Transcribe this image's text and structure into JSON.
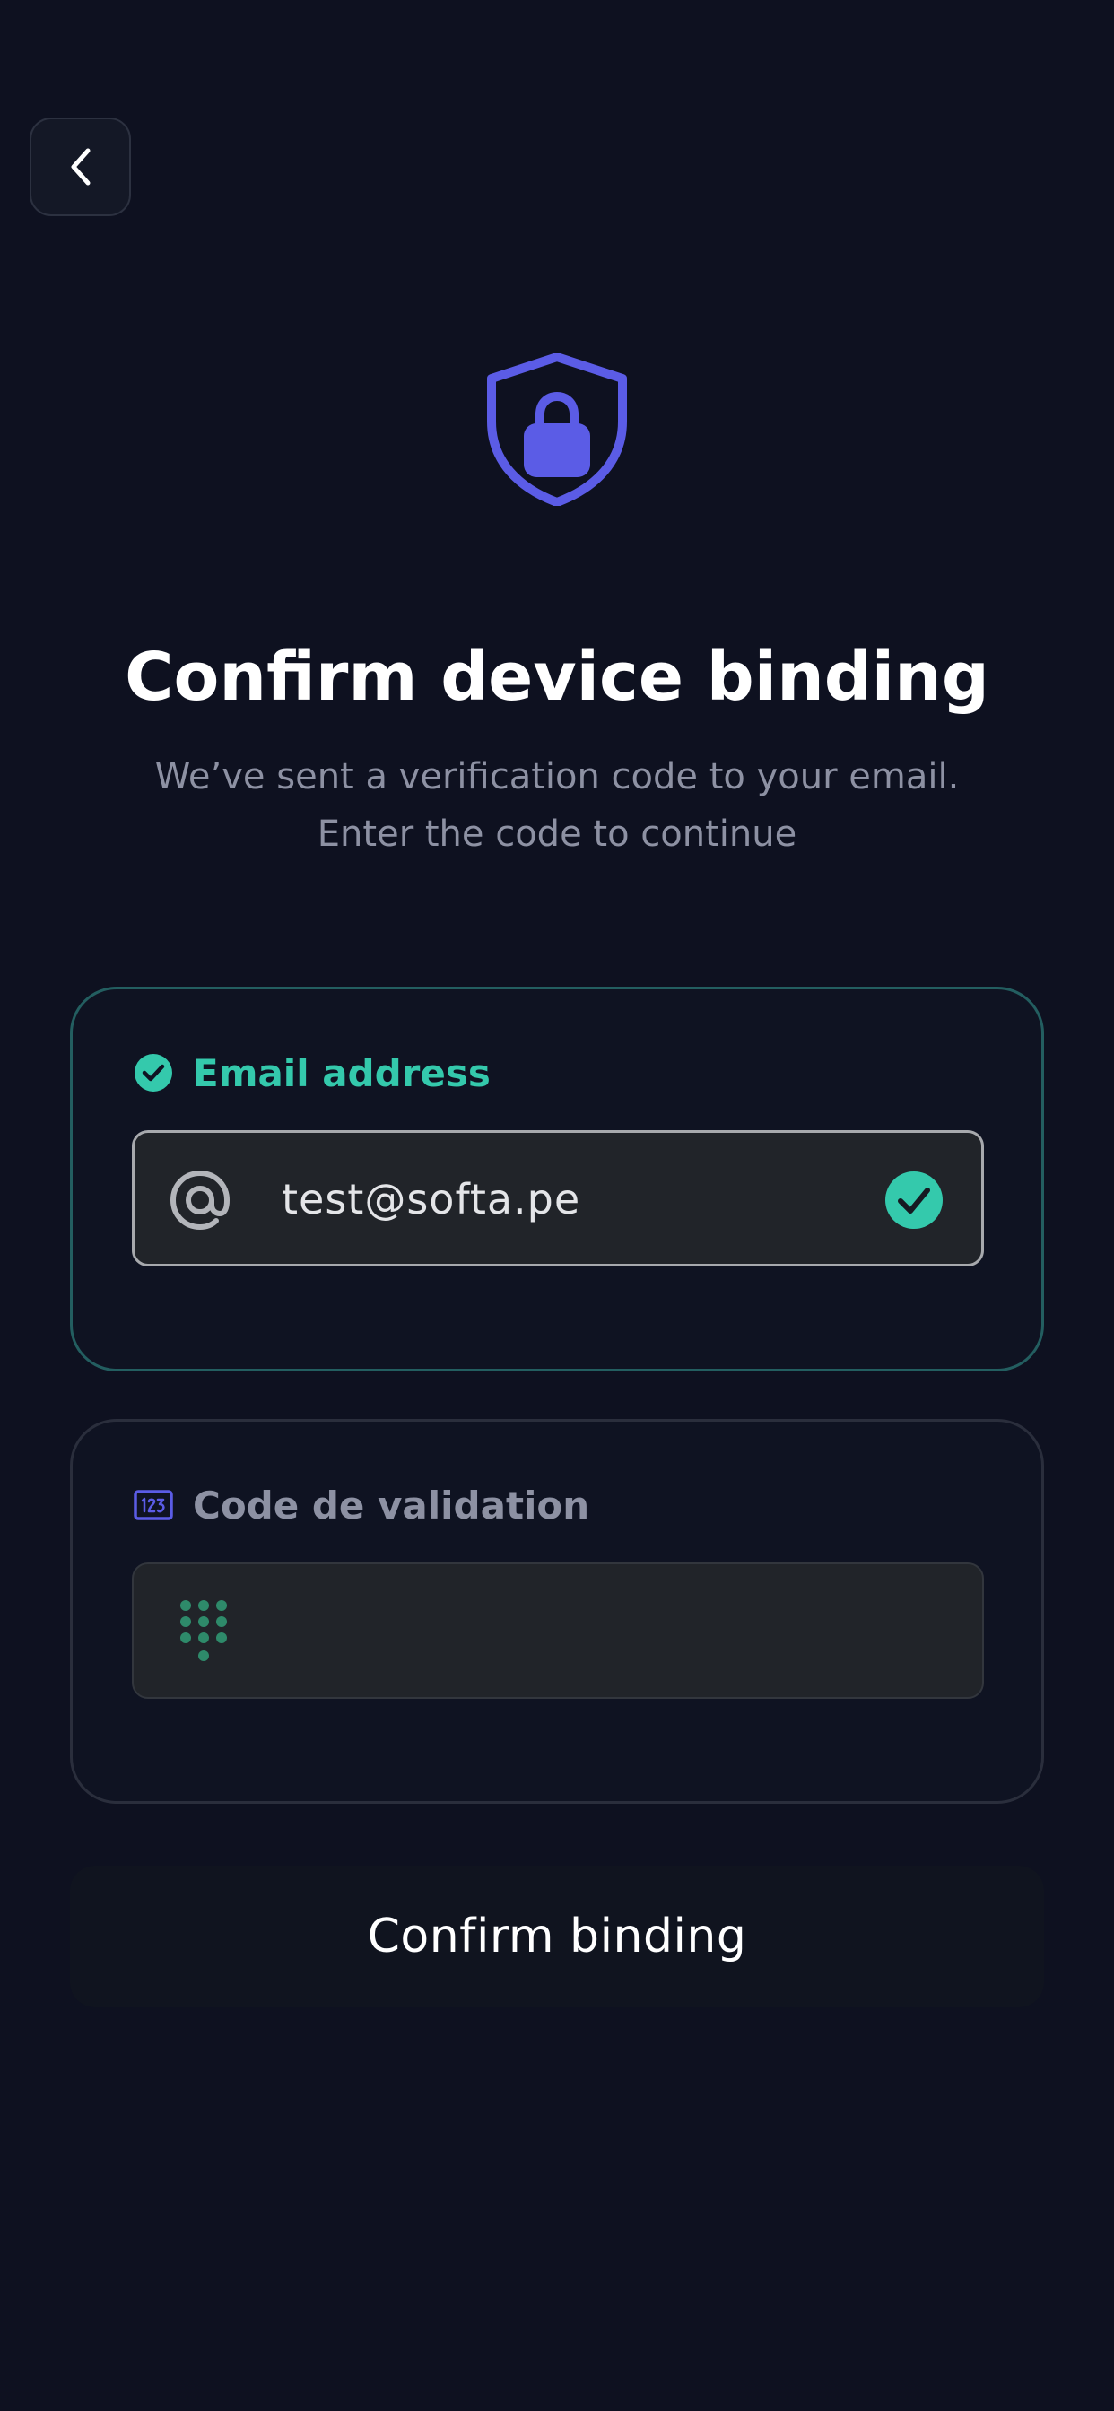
{
  "header": {
    "back_icon": "chevron-left-icon",
    "hero_icon": "shield-lock-icon"
  },
  "title": "Confirm device binding",
  "subtitle": {
    "line1": "We’ve sent a verification code to your email.",
    "line2": "Enter the code to continue"
  },
  "email_card": {
    "label": "Email address",
    "label_icon": "check-circle-icon",
    "field_icon": "at-sign-icon",
    "value": "test@softa.pe",
    "status_icon": "check-circle-icon",
    "accent_color": "#34c9ac"
  },
  "code_card": {
    "label": "Code de validation",
    "label_icon": "numeric-123-icon",
    "field_icon": "keypad-icon",
    "value": ""
  },
  "confirm_button": {
    "label": "Confirm binding"
  },
  "colors": {
    "background": "#0e1120",
    "brand": "#5b5ce6",
    "success": "#34c9ac"
  }
}
